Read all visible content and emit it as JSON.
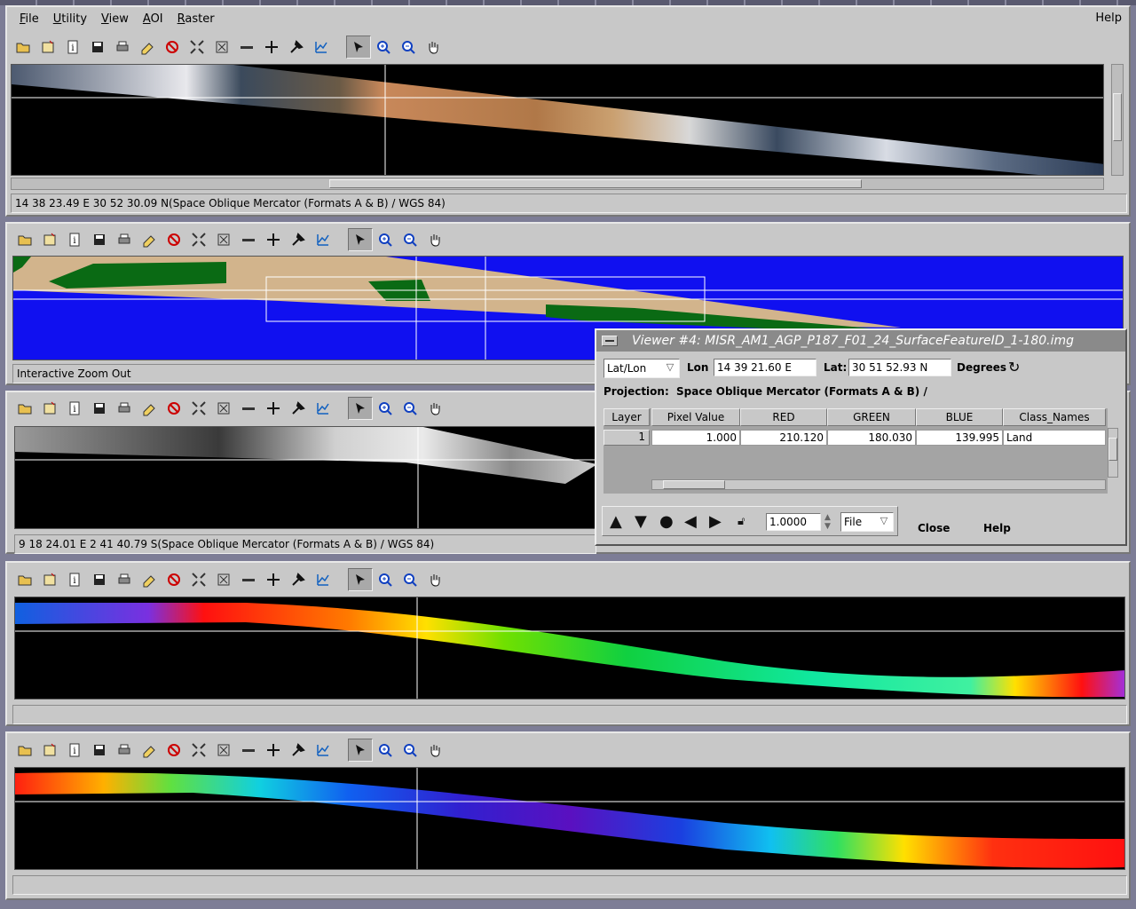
{
  "menubar": {
    "items": [
      {
        "label": "File",
        "mnemonic": "F",
        "rest": "ile"
      },
      {
        "label": "Utility",
        "mnemonic": "U",
        "rest": "tility"
      },
      {
        "label": "View",
        "mnemonic": "V",
        "rest": "iew"
      },
      {
        "label": "AOI",
        "mnemonic": "A",
        "rest": "OI"
      },
      {
        "label": "Raster",
        "mnemonic": "R",
        "rest": "aster"
      }
    ],
    "help": "Help"
  },
  "toolbar_icons": [
    "open-folder-icon",
    "new-viewer-icon",
    "info-icon",
    "save-icon",
    "print-icon",
    "eraser-icon",
    "clear-icon",
    "fit-icon",
    "reset-icon",
    "measure-icon",
    "crosshair-icon",
    "tools-icon",
    "profile-icon",
    "select-arrow-icon",
    "zoom-in-icon",
    "zoom-out-icon",
    "pan-hand-icon"
  ],
  "viewers": [
    {
      "status": "14 38 23.49 E   30 52 30.09 N(Space Oblique Mercator (Formats A & B) / WGS 84)"
    },
    {
      "status": "Interactive Zoom Out"
    },
    {
      "status": "9 18 24.01 E   2 41 40.79 S(Space Oblique Mercator (Formats A & B) / WGS 84)"
    },
    {
      "status": ""
    },
    {
      "status": ""
    }
  ],
  "dialog": {
    "title": "Viewer #4:  MISR_AM1_AGP_P187_F01_24_SurfaceFeatureID_1-180.img",
    "coord_type": "Lat/Lon",
    "lon_label": "Lon",
    "lon_value": "14 39 21.60 E",
    "lat_label": "Lat:",
    "lat_value": "30 51 52.93 N",
    "units": "Degrees",
    "projection_label": "Projection:",
    "projection_value": "Space Oblique Mercator (Formats A & B) /",
    "table": {
      "headers": [
        "Layer",
        "Pixel Value",
        "RED",
        "GREEN",
        "BLUE",
        "Class_Names"
      ],
      "rows": [
        {
          "layer": "1",
          "pixel_value": "1.000",
          "red": "210.120",
          "green": "180.030",
          "blue": "139.995",
          "class_name": "Land"
        }
      ]
    },
    "step_value": "1.0000",
    "step_mode": "File",
    "close": "Close",
    "help": "Help"
  },
  "colors": {
    "window_bg": "#c8c8c8",
    "desktop": "#7d7d96",
    "classification_blue": "#1010f0",
    "land_tan": "#d2b48c",
    "vegetation_green": "#0a6a14"
  }
}
